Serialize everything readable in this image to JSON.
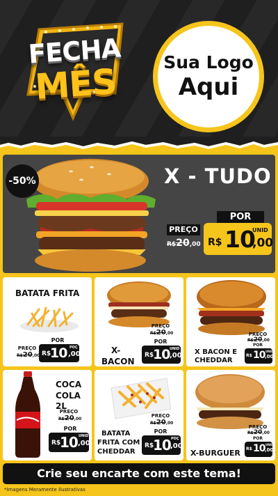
{
  "header": {
    "badge_line1": "FECHA",
    "badge_line2": "MÊS",
    "logo_line1": "Sua Logo",
    "logo_line2": "Aqui"
  },
  "hero": {
    "discount": "-50%",
    "title": "X - TUDO",
    "old_label": "PREÇO",
    "old_currency": "R$",
    "old_amount": "20",
    "old_cents": ",00",
    "por_label": "POR",
    "currency": "R$",
    "amount": "10",
    "unit": "UNID",
    "cents": ",00"
  },
  "products": [
    {
      "name": "BATATA FRITA",
      "old_label": "PREÇO",
      "old_currency": "R$",
      "old_amount": "20",
      "old_cents": ",00",
      "por_label": "POR",
      "currency": "R$",
      "amount": "10",
      "unit": "POÇ",
      "cents": ",00"
    },
    {
      "name_line1": "X-",
      "name_line2": "BACON",
      "old_label": "PREÇO",
      "old_currency": "R$",
      "old_amount": "20",
      "old_cents": ",00",
      "por_label": "POR",
      "currency": "R$",
      "amount": "10",
      "unit": "UNID",
      "cents": ",00"
    },
    {
      "name_line1": "X BACON E",
      "name_line2": "CHEDDAR",
      "old_label": "PREÇO",
      "old_currency": "R$",
      "old_amount": "20",
      "old_cents": ",00",
      "por_label": "POR",
      "currency": "R$",
      "amount": "10",
      "unit": "UNID",
      "cents": ",00"
    },
    {
      "name_line1": "COCA",
      "name_line2": "COLA 2L",
      "old_label": "PREÇO",
      "old_currency": "R$",
      "old_amount": "20",
      "old_cents": ",00",
      "por_label": "POR",
      "currency": "R$",
      "amount": "10",
      "unit": "UNID",
      "cents": ",00"
    },
    {
      "name_line1": "BATATA",
      "name_line2": "FRITA COM",
      "name_line3": "CHEDDAR",
      "old_label": "PREÇO",
      "old_currency": "R$",
      "old_amount": "20",
      "old_cents": ",00",
      "por_label": "POR",
      "currency": "R$",
      "amount": "10",
      "unit": "POÇ",
      "cents": ",00"
    },
    {
      "name": "X-BURGUER",
      "old_label": "PREÇO",
      "old_currency": "R$",
      "old_amount": "20",
      "old_cents": ",00",
      "por_label": "POR",
      "currency": "R$",
      "amount": "10",
      "unit": "UNID",
      "cents": ",00"
    }
  ],
  "footer": {
    "cta": "Crie seu encarte com este tema!",
    "note": "*Imagens Meramente Ilustrativas"
  },
  "colors": {
    "accent": "#f6c51b",
    "dark": "#111111",
    "hero_bg": "#454545"
  }
}
